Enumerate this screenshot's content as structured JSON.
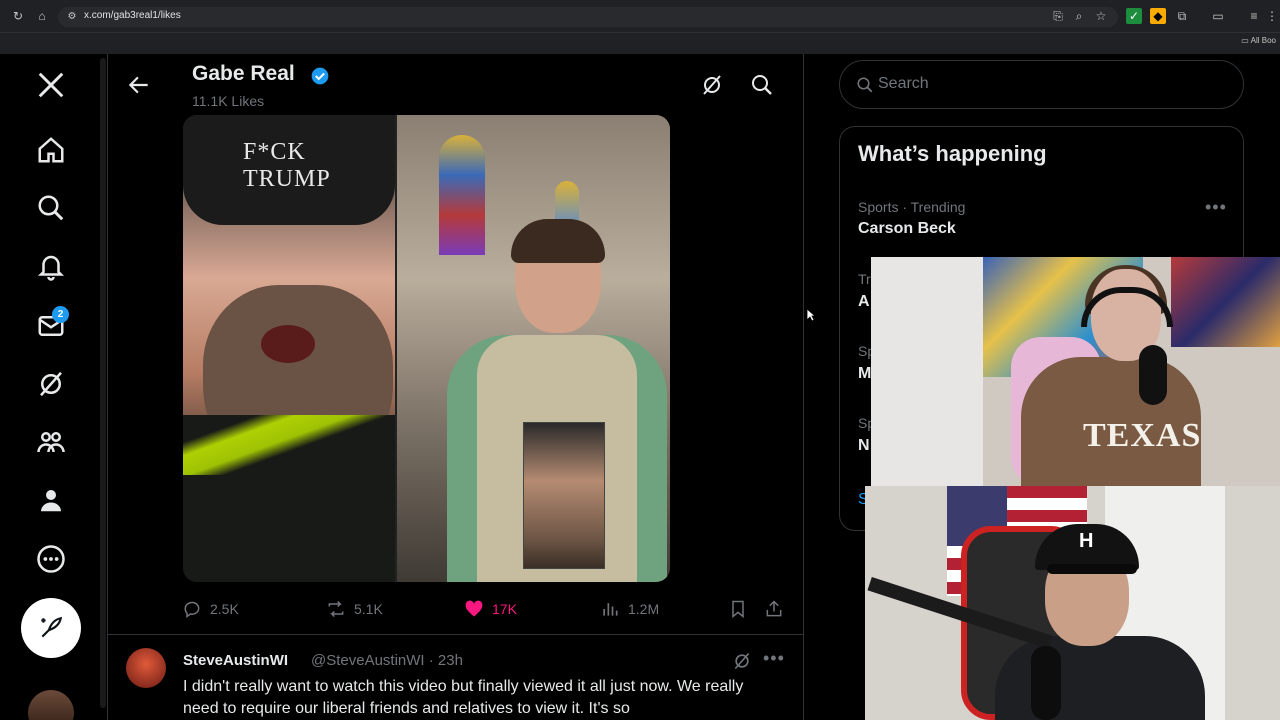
{
  "browser": {
    "url": "x.com/gab3real1/likes",
    "all_bookmarks": "All Boo"
  },
  "nav": {
    "messages_badge": "2"
  },
  "profile": {
    "name": "Gabe Real",
    "likes": "11.1K Likes"
  },
  "media": {
    "beanie_text": "F*CK TRUMP"
  },
  "post_actions": {
    "replies": "2.5K",
    "reposts": "5.1K",
    "likes": "17K",
    "views": "1.2M"
  },
  "reply": {
    "name": "SteveAustinWI",
    "handle": "@SteveAustinWI · 23h",
    "text": "I didn't really want to watch this video but finally viewed it all just now. We really need to require our liberal friends and relatives to view it. It's so"
  },
  "sidebar": {
    "search_placeholder": "Search",
    "trends_title": "What’s happening",
    "trend1_meta": "Sports · Trending",
    "trend1_name": "Carson Beck",
    "partials": [
      "Tr",
      "A",
      "Sp",
      "M",
      "Sp",
      "N",
      "S"
    ]
  },
  "overlays": {
    "shirt_text": "TEXAS",
    "cap_logo": "H"
  },
  "colors": {
    "accent": "#1d9bf0",
    "like": "#f91880",
    "background": "#000000",
    "muted": "#71767b"
  }
}
